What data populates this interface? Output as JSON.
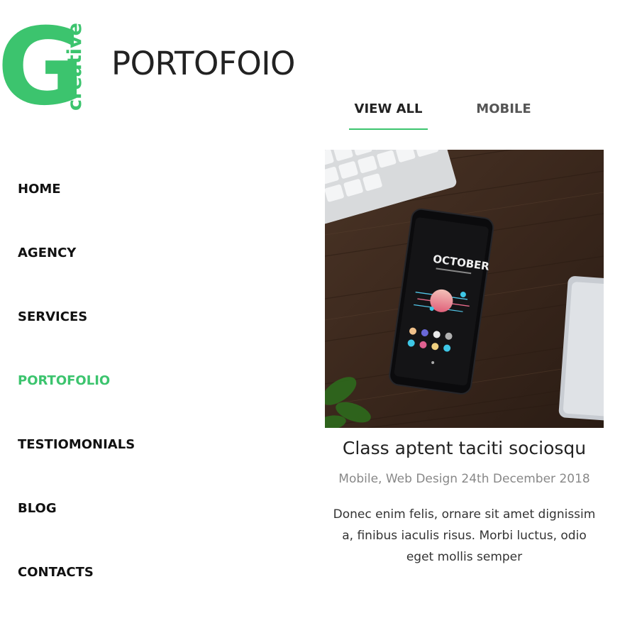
{
  "brand": {
    "letter": "G",
    "word": "creative",
    "color": "#3cc46e"
  },
  "page": {
    "title": "PORTOFOIO"
  },
  "filters": [
    {
      "label": "VIEW ALL",
      "active": true
    },
    {
      "label": "MOBILE",
      "active": false
    }
  ],
  "nav": {
    "items": [
      {
        "label": "HOME"
      },
      {
        "label": "AGENCY"
      },
      {
        "label": "SERVICES"
      },
      {
        "label": "PORTOFOLIO",
        "active": true
      },
      {
        "label": "TESTIOMONIALS"
      },
      {
        "label": "BLOG"
      },
      {
        "label": "CONTACTS"
      }
    ]
  },
  "post": {
    "image_alt": "smartphone-on-wooden-desk-photo",
    "phone_screen_text": "OCTOBER",
    "title": "Class aptent taciti sociosqu",
    "meta": "Mobile, Web Design 24th December 2018",
    "excerpt": "Donec enim felis, ornare sit amet dignissim a, finibus iaculis risus. Morbi luctus, odio eget mollis semper"
  },
  "colors": {
    "accent": "#3cc46e",
    "text": "#222222",
    "muted": "#888888"
  }
}
